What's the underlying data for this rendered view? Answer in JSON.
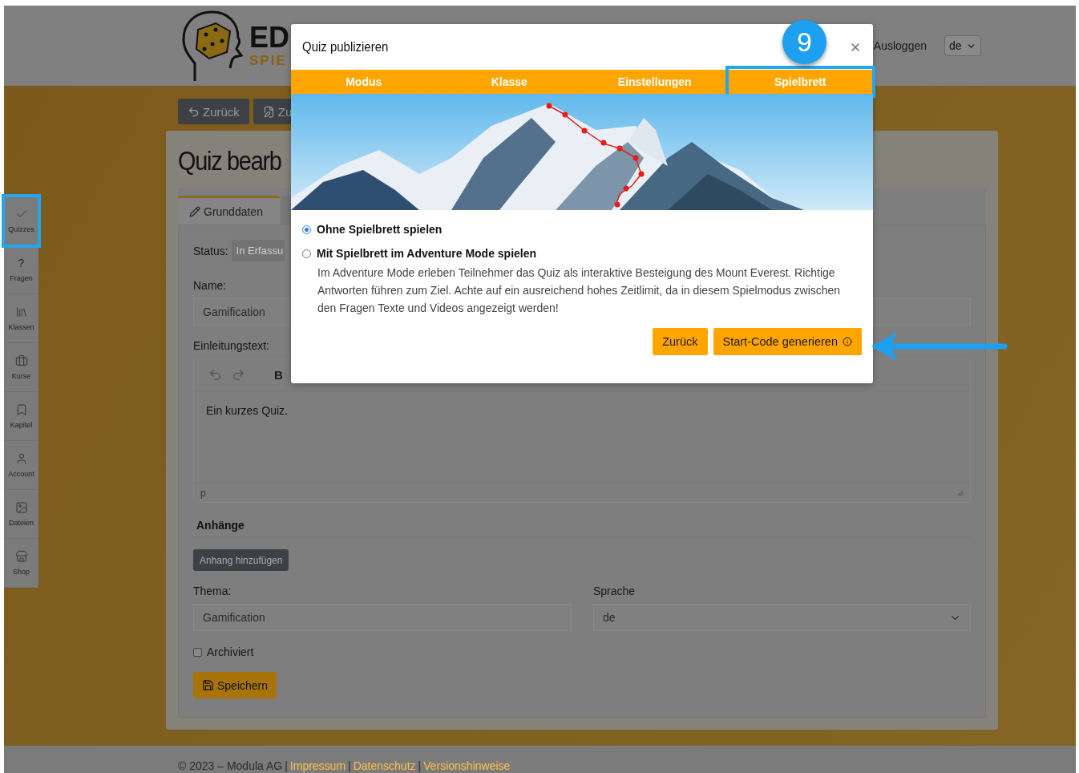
{
  "header": {
    "logo": {
      "line_1": "ED",
      "line_2": "SPIE"
    },
    "logout": "Ausloggen",
    "language": "de"
  },
  "sidebar": {
    "items": [
      {
        "label": "Quizzes",
        "highlighted": true
      },
      {
        "label": "Fragen",
        "glyph": "?",
        "highlighted": false
      },
      {
        "label": "Klassen",
        "highlighted": false
      },
      {
        "label": "Kurse",
        "highlighted": false
      },
      {
        "label": "Kapitel",
        "highlighted": false
      },
      {
        "label": "Account",
        "highlighted": false
      },
      {
        "label": "Dateien",
        "highlighted": false
      },
      {
        "label": "Shop",
        "highlighted": false
      }
    ]
  },
  "toolbar": {
    "buttons": [
      "Zurück",
      "Zu"
    ]
  },
  "editor": {
    "title": "Quiz bearb",
    "tab": "Grunddaten",
    "status": {
      "label": "Status:",
      "value": "In Erfassu"
    },
    "name": {
      "label": "Name:",
      "value": "Gamification"
    },
    "intro": {
      "label": "Einleitungstext:",
      "bold_button": "B",
      "content": "Ein kurzes Quiz.",
      "path": "p"
    },
    "attachments": {
      "heading": "Anhänge",
      "button": "Anhang hinzufügen"
    },
    "theme": {
      "label": "Thema:",
      "value": "Gamification"
    },
    "language": {
      "label": "Sprache",
      "value": "de"
    },
    "archived": {
      "label": "Archiviert",
      "checked": false
    },
    "save": "Speichern"
  },
  "footer": {
    "copyright": "© 2023 – Modula AG",
    "separator": "|",
    "links": [
      "Impressum",
      "Datenschutz",
      "Versionshinweise"
    ]
  },
  "modal": {
    "title": "Quiz publizieren",
    "tabs": [
      {
        "label": "Modus",
        "highlighted": false
      },
      {
        "label": "Klasse",
        "highlighted": false
      },
      {
        "label": "Einstellungen",
        "highlighted": false
      },
      {
        "label": "Spielbrett",
        "highlighted": true
      }
    ],
    "options": [
      {
        "label": "Ohne Spielbrett spielen",
        "selected": true
      },
      {
        "label": "Mit Spielbrett im Adventure Mode spielen",
        "selected": false,
        "description": "Im Adventure Mode erleben Teilnehmer das Quiz als interaktive Besteigung des Mount Everest. Richtige Antworten führen zum Ziel. Achte auf ein ausreichend hohes Zeitlimit, da in diesem Spielmodus zwischen den Fragen Texte und Videos angezeigt werden!"
      }
    ],
    "buttons": [
      {
        "label": "Zurück",
        "kind": "plain"
      },
      {
        "label": "Start-Code generieren",
        "kind": "info"
      }
    ]
  },
  "annotation": {
    "step_badge": "9"
  }
}
